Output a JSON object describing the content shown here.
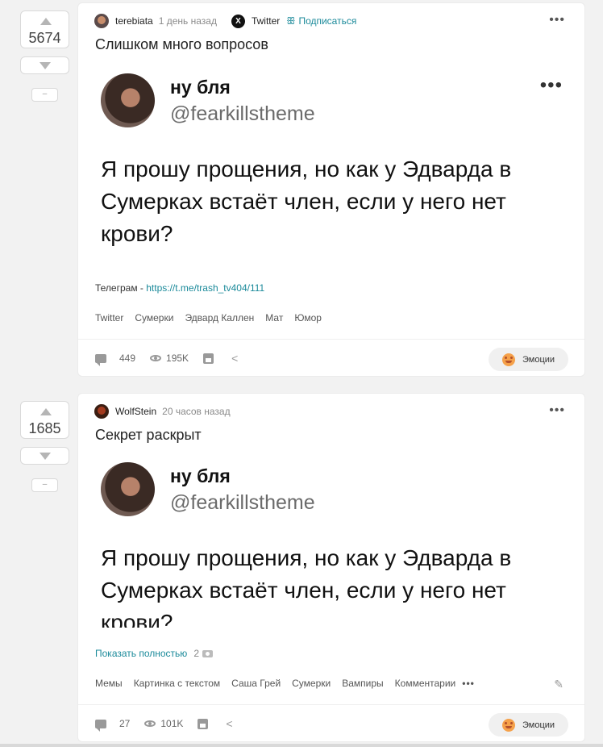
{
  "posts": [
    {
      "rating": "5674",
      "minus_label": "–",
      "author": "terebiata",
      "time": "1 день назад",
      "community": {
        "icon": "X",
        "name": "Twitter"
      },
      "subscribe_label": "Подписаться",
      "menu_icon": "•••",
      "title": "Слишком много вопросов",
      "tweet": {
        "name": "ну бля",
        "handle": "@fearkillstheme",
        "dots": "•••",
        "text": "Я прошу прощения, но как у Эдварда в Сумерках встаёт член, если у него нет крови?"
      },
      "telegram_label": "Телеграм - ",
      "telegram_link": "https://t.me/trash_tv404/111",
      "tags": [
        "Twitter",
        "Сумерки",
        "Эдвард Каллен",
        "Мат",
        "Юмор"
      ],
      "comments": "449",
      "views": "195K",
      "emotions_label": "Эмоции"
    },
    {
      "rating": "1685",
      "minus_label": "–",
      "author": "WolfStein",
      "time": "20 часов назад",
      "menu_icon": "•••",
      "title": "Секрет раскрыт",
      "tweet": {
        "name": "ну бля",
        "handle": "@fearkillstheme",
        "text": "Я прошу прощения, но как у Эдварда в Сумерках встаёт член, если у него нет крови?"
      },
      "show_more_label": "Показать полностью",
      "show_more_count": "2",
      "tags": [
        "Мемы",
        "Картинка с текстом",
        "Саша Грей",
        "Сумерки",
        "Вампиры",
        "Комментарии"
      ],
      "tags_more": "•••",
      "comments": "27",
      "views": "101K",
      "emotions_label": "Эмоции"
    }
  ],
  "icons": {
    "upvote": "triangle-up-icon",
    "downvote": "triangle-down-icon",
    "comment": "comment-icon",
    "views": "eye-icon",
    "save": "save-icon",
    "share": "share-icon",
    "edit": "pencil-icon",
    "emotion": "emoji-face-icon",
    "photo": "camera-icon"
  },
  "colors": {
    "accent": "#1b8a9a",
    "background": "#f2f2f2",
    "card": "#ffffff"
  }
}
